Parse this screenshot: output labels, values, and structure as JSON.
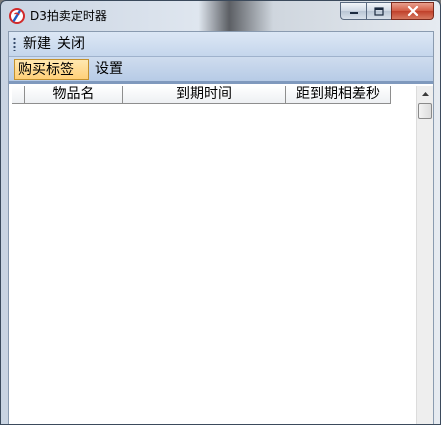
{
  "window": {
    "title": "D3拍卖定时器",
    "icon": "app-logo-icon",
    "controls": [
      "minimize-icon",
      "maximize-icon",
      "close-icon"
    ]
  },
  "menu": {
    "items": [
      {
        "label": "新建"
      },
      {
        "label": "关闭"
      }
    ]
  },
  "tabs": [
    {
      "label": "购买标签",
      "active": true
    },
    {
      "label": "设置",
      "active": false
    }
  ],
  "table": {
    "columns": [
      "",
      "物品名",
      "到期时间",
      "距到期相差秒"
    ],
    "rows": []
  },
  "colors": {
    "accent_tab": "#ffd079",
    "menubar": "#c5d6ec",
    "close_button": "#c0402a"
  }
}
